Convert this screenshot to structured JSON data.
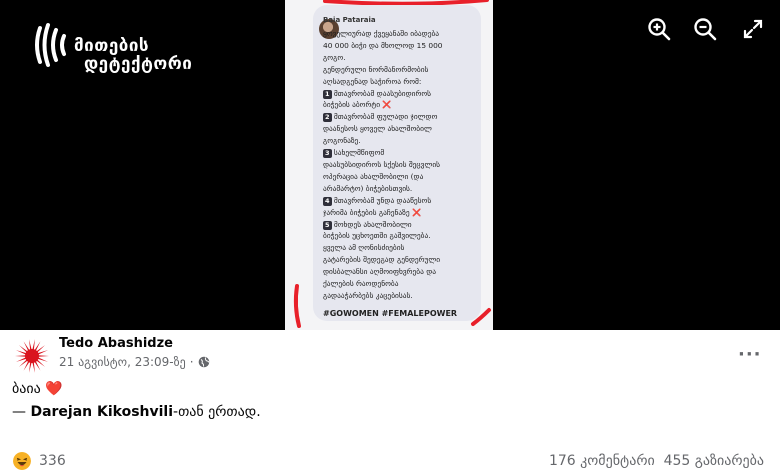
{
  "viewer": {
    "logo": {
      "line1": "მითების",
      "line2": "დეტექტორი"
    },
    "icons": [
      "zoom-in-icon",
      "zoom-out-icon",
      "fullscreen-icon"
    ]
  },
  "screenshot": {
    "author": "Baia Pataraia",
    "text_lines": [
      "ყოველიურად ქვეყანაში იბადება",
      "40 000 ბიჭი და მხოლოდ 15 000",
      "გოგო.",
      "გენდერული ნორმანორმობის",
      "აღსადგენად საჭიროა რომ:",
      "1. მთავრობამ დაასუბიდიროს",
      "ბიჭების აბორტი ❌",
      "2. მთავრობამ ფულადი ჯილდო",
      "დაანესოს ყოველ ახალშობილ",
      "გოგონაზე.",
      "3. სახელმწიფომ",
      "დაასუბსიდიროს სქესის შეცვლის",
      "ოპერაცია ახალშობილი (და",
      "არამარტო) ბიჭებისთვის.",
      "4. მთავრობამ უნდა დააწესოს",
      "ჯარიმა ბიჭების გაჩენაზე ❌",
      "5. მოხდეს ახალშობილი",
      "ბიჭების უცხოეთში გაშვილება.",
      "ყველა ამ ღონისძიების",
      "გატარების შედეგად გენდერული",
      "დისბალანსი აღმოიფხვრება და",
      "ქალების რაოდენობა",
      "გადააჭარბებს კაცებისას."
    ],
    "hashtags": "#GOWOMEN #FEMALEPOWER",
    "highlight_color": "#e8202a"
  },
  "post": {
    "author": "Tedo Abashidze",
    "timestamp": "21 აგვისტო, 23:09-ზე",
    "dot": "·",
    "caption_text": "ბაია",
    "caption_emoji": "❤️",
    "tag_prefix": "— ",
    "tag_name": "Darejan Kikoshvili",
    "tag_suffix": "-თან ერთად.",
    "more_label": "···"
  },
  "footer": {
    "reaction_icon": "haha-icon",
    "reaction_count": "336",
    "comments": "176 კომენტარი",
    "shares": "455 გაზიარება"
  },
  "colors": {
    "viewer_bg": "#000000",
    "text_secondary": "#65676b",
    "heart": "#e41e3f",
    "reaction": "#f7b125"
  }
}
